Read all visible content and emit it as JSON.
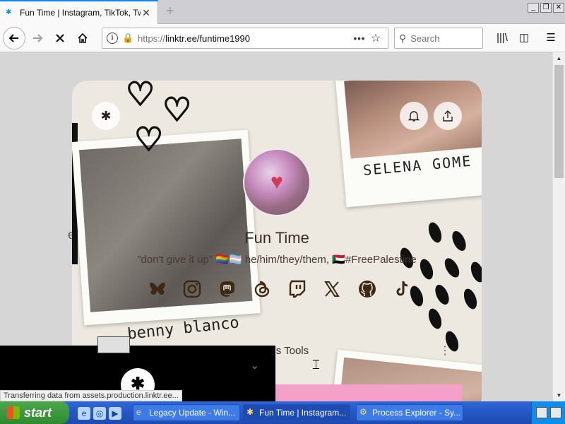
{
  "browser": {
    "tab_title": "Fun Time | Instagram, TikTok, Twi",
    "tab_close": "✕",
    "new_tab": "+",
    "window_buttons": [
      "_",
      "❐",
      "✕"
    ],
    "url_prefix": "https://",
    "url_main": "linktr.ee/funtime1990",
    "url_dots": "•••",
    "search_placeholder": "Search"
  },
  "page": {
    "name": "Fun Time",
    "bio": "\"don't give it up\" 🏳️‍🌈🏳️‍⚧️ he/him/they/them, 🇸🇩#FreePalestine",
    "photo_caption_left": "benny blanco",
    "photo_caption_right": "SELENA GOME",
    "socials": [
      "bluesky",
      "instagram",
      "mastodon",
      "threads",
      "twitch",
      "x",
      "github",
      "tiktok"
    ],
    "link_label": "ce's Tools",
    "link_more": "⋮",
    "edge_letter": "e"
  },
  "status": {
    "text": "Transferring data from assets.production.linktr.ee..."
  },
  "taskbar": {
    "start": "start",
    "items": [
      {
        "label": "Legacy Update - Win..."
      },
      {
        "label": "Fun Time | Instagram..."
      },
      {
        "label": "Process Explorer - Sy..."
      }
    ]
  }
}
